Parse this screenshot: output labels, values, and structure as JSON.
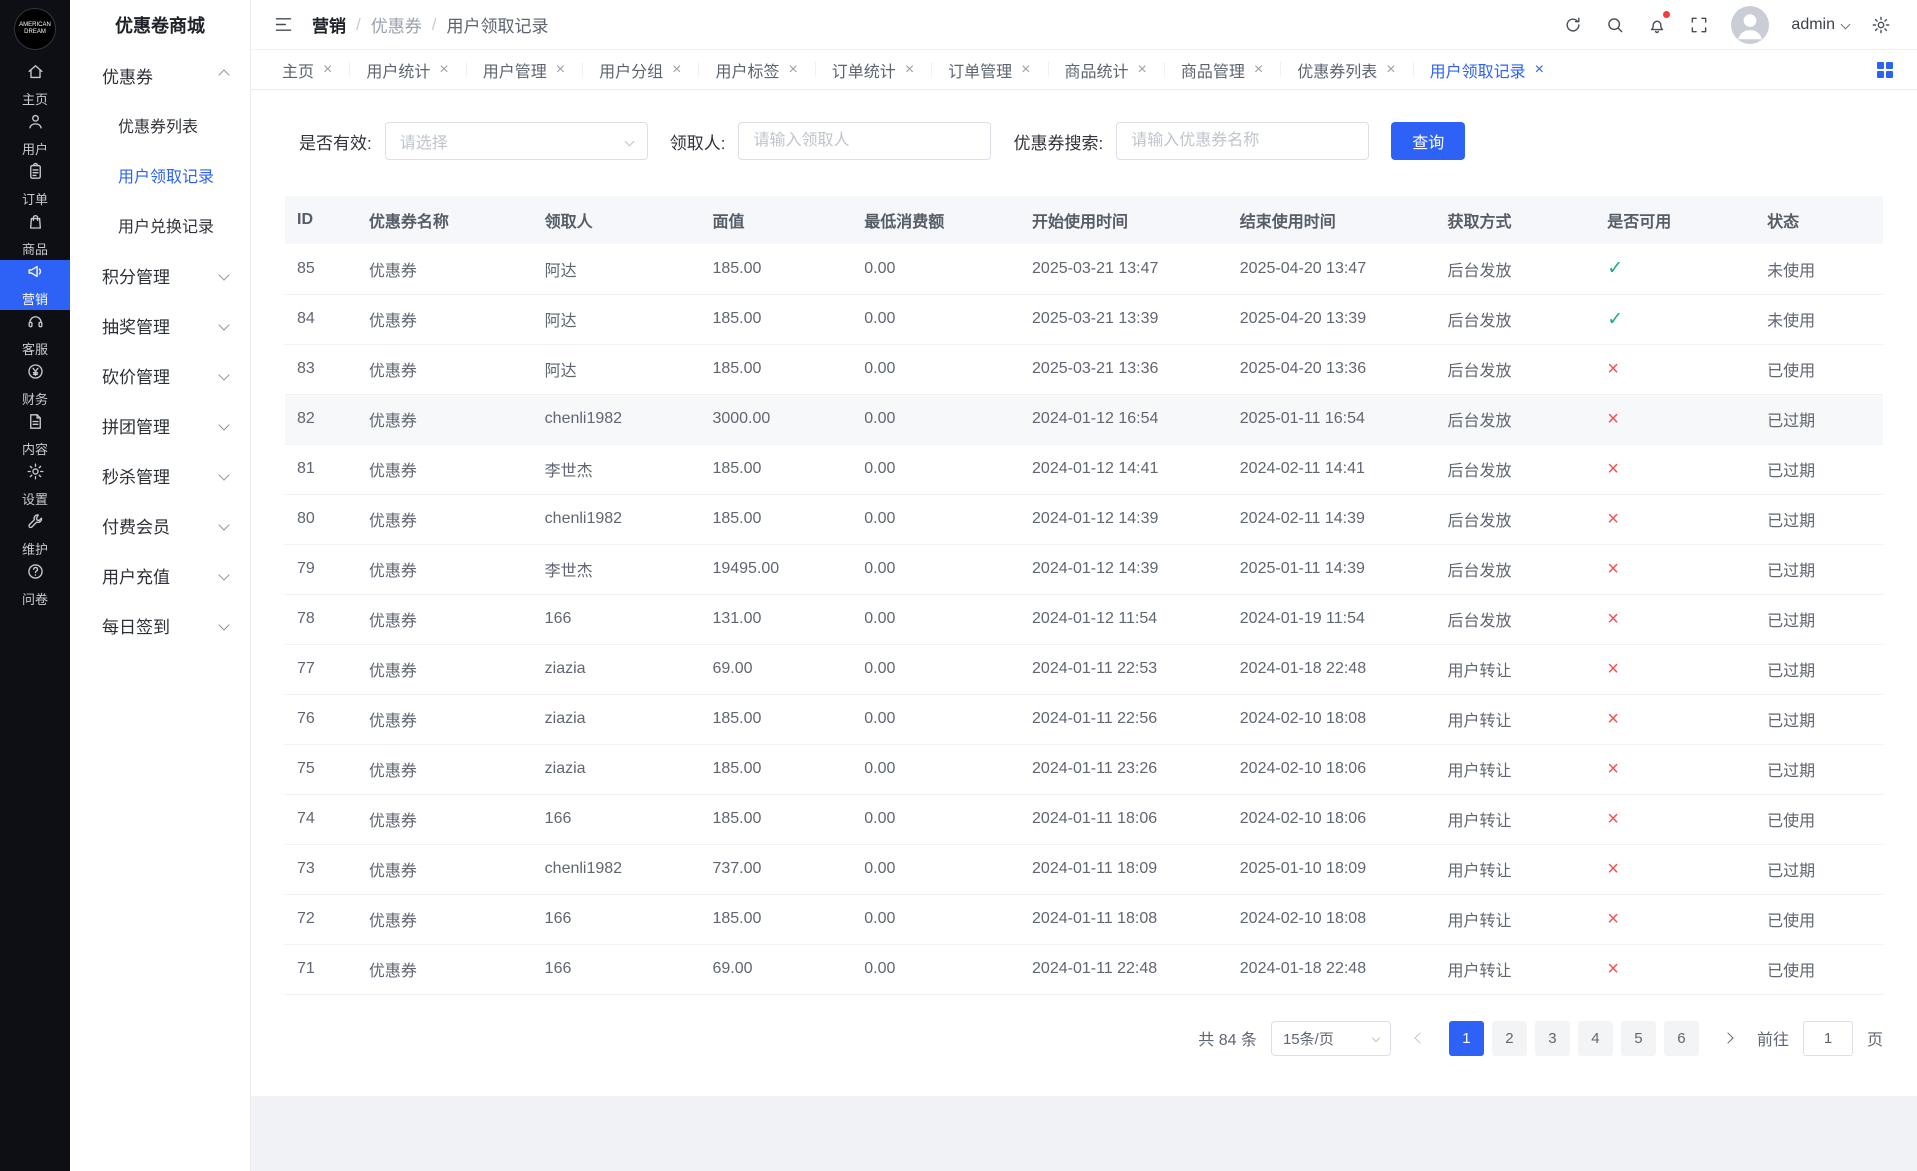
{
  "app": {
    "title": "优惠卷商城",
    "logo_text": "AMERICAN DREAM"
  },
  "ui": {
    "close_glyph": "×",
    "check_glyph": "✓",
    "cross_glyph": "×"
  },
  "colors": {
    "accent": "#2e62f6",
    "success": "#17b07f",
    "danger": "#f25050"
  },
  "rail": {
    "items": [
      {
        "label": "主页",
        "icon": "home",
        "active": false
      },
      {
        "label": "用户",
        "icon": "user",
        "active": false
      },
      {
        "label": "订单",
        "icon": "order",
        "active": false
      },
      {
        "label": "商品",
        "icon": "goods",
        "active": false
      },
      {
        "label": "营销",
        "icon": "marketing",
        "active": true
      },
      {
        "label": "客服",
        "icon": "service",
        "active": false
      },
      {
        "label": "财务",
        "icon": "finance",
        "active": false
      },
      {
        "label": "内容",
        "icon": "content",
        "active": false
      },
      {
        "label": "设置",
        "icon": "settings",
        "active": false
      },
      {
        "label": "维护",
        "icon": "maintain",
        "active": false
      },
      {
        "label": "问卷",
        "icon": "survey",
        "active": false
      }
    ]
  },
  "sidebar": {
    "groups": [
      {
        "label": "优惠券",
        "expanded": true,
        "children": [
          {
            "label": "优惠券列表",
            "active": false
          },
          {
            "label": "用户领取记录",
            "active": true
          },
          {
            "label": "用户兑换记录",
            "active": false
          }
        ]
      },
      {
        "label": "积分管理",
        "expanded": false,
        "children": []
      },
      {
        "label": "抽奖管理",
        "expanded": false,
        "children": []
      },
      {
        "label": "砍价管理",
        "expanded": false,
        "children": []
      },
      {
        "label": "拼团管理",
        "expanded": false,
        "children": []
      },
      {
        "label": "秒杀管理",
        "expanded": false,
        "children": []
      },
      {
        "label": "付费会员",
        "expanded": false,
        "children": []
      },
      {
        "label": "用户充值",
        "expanded": false,
        "children": []
      },
      {
        "label": "每日签到",
        "expanded": false,
        "children": []
      }
    ]
  },
  "header": {
    "breadcrumb": [
      "营销",
      "优惠券",
      "用户领取记录"
    ],
    "username": "admin"
  },
  "tabs": {
    "items": [
      {
        "label": "主页",
        "active": false
      },
      {
        "label": "用户统计",
        "active": false
      },
      {
        "label": "用户管理",
        "active": false
      },
      {
        "label": "用户分组",
        "active": false
      },
      {
        "label": "用户标签",
        "active": false
      },
      {
        "label": "订单统计",
        "active": false
      },
      {
        "label": "订单管理",
        "active": false
      },
      {
        "label": "商品统计",
        "active": false
      },
      {
        "label": "商品管理",
        "active": false
      },
      {
        "label": "优惠券列表",
        "active": false
      },
      {
        "label": "用户领取记录",
        "active": true
      }
    ]
  },
  "filters": {
    "valid_label": "是否有效:",
    "valid_placeholder": "请选择",
    "receiver_label": "领取人:",
    "receiver_placeholder": "请输入领取人",
    "coupon_label": "优惠券搜索:",
    "coupon_placeholder": "请输入优惠券名称",
    "search_button": "查询"
  },
  "table": {
    "columns": [
      "ID",
      "优惠券名称",
      "领取人",
      "面值",
      "最低消费额",
      "开始使用时间",
      "结束使用时间",
      "获取方式",
      "是否可用",
      "状态"
    ],
    "rows": [
      {
        "id": "85",
        "name": "优惠券",
        "receiver": "阿达",
        "value": "185.00",
        "min": "0.00",
        "start": "2025-03-21 13:47",
        "end": "2025-04-20 13:47",
        "method": "后台发放",
        "available": true,
        "status": "未使用",
        "highlighted": false
      },
      {
        "id": "84",
        "name": "优惠券",
        "receiver": "阿达",
        "value": "185.00",
        "min": "0.00",
        "start": "2025-03-21 13:39",
        "end": "2025-04-20 13:39",
        "method": "后台发放",
        "available": true,
        "status": "未使用",
        "highlighted": false
      },
      {
        "id": "83",
        "name": "优惠券",
        "receiver": "阿达",
        "value": "185.00",
        "min": "0.00",
        "start": "2025-03-21 13:36",
        "end": "2025-04-20 13:36",
        "method": "后台发放",
        "available": false,
        "status": "已使用",
        "highlighted": false
      },
      {
        "id": "82",
        "name": "优惠券",
        "receiver": "chenli1982",
        "value": "3000.00",
        "min": "0.00",
        "start": "2024-01-12 16:54",
        "end": "2025-01-11 16:54",
        "method": "后台发放",
        "available": false,
        "status": "已过期",
        "highlighted": true
      },
      {
        "id": "81",
        "name": "优惠券",
        "receiver": "李世杰",
        "value": "185.00",
        "min": "0.00",
        "start": "2024-01-12 14:41",
        "end": "2024-02-11 14:41",
        "method": "后台发放",
        "available": false,
        "status": "已过期",
        "highlighted": false
      },
      {
        "id": "80",
        "name": "优惠券",
        "receiver": "chenli1982",
        "value": "185.00",
        "min": "0.00",
        "start": "2024-01-12 14:39",
        "end": "2024-02-11 14:39",
        "method": "后台发放",
        "available": false,
        "status": "已过期",
        "highlighted": false
      },
      {
        "id": "79",
        "name": "优惠券",
        "receiver": "李世杰",
        "value": "19495.00",
        "min": "0.00",
        "start": "2024-01-12 14:39",
        "end": "2025-01-11 14:39",
        "method": "后台发放",
        "available": false,
        "status": "已过期",
        "highlighted": false
      },
      {
        "id": "78",
        "name": "优惠券",
        "receiver": "166",
        "value": "131.00",
        "min": "0.00",
        "start": "2024-01-12 11:54",
        "end": "2024-01-19 11:54",
        "method": "后台发放",
        "available": false,
        "status": "已过期",
        "highlighted": false
      },
      {
        "id": "77",
        "name": "优惠券",
        "receiver": "ziazia",
        "value": "69.00",
        "min": "0.00",
        "start": "2024-01-11 22:53",
        "end": "2024-01-18 22:48",
        "method": "用户转让",
        "available": false,
        "status": "已过期",
        "highlighted": false
      },
      {
        "id": "76",
        "name": "优惠券",
        "receiver": "ziazia",
        "value": "185.00",
        "min": "0.00",
        "start": "2024-01-11 22:56",
        "end": "2024-02-10 18:08",
        "method": "用户转让",
        "available": false,
        "status": "已过期",
        "highlighted": false
      },
      {
        "id": "75",
        "name": "优惠券",
        "receiver": "ziazia",
        "value": "185.00",
        "min": "0.00",
        "start": "2024-01-11 23:26",
        "end": "2024-02-10 18:06",
        "method": "用户转让",
        "available": false,
        "status": "已过期",
        "highlighted": false
      },
      {
        "id": "74",
        "name": "优惠券",
        "receiver": "166",
        "value": "185.00",
        "min": "0.00",
        "start": "2024-01-11 18:06",
        "end": "2024-02-10 18:06",
        "method": "用户转让",
        "available": false,
        "status": "已使用",
        "highlighted": false
      },
      {
        "id": "73",
        "name": "优惠券",
        "receiver": "chenli1982",
        "value": "737.00",
        "min": "0.00",
        "start": "2024-01-11 18:09",
        "end": "2025-01-10 18:09",
        "method": "用户转让",
        "available": false,
        "status": "已过期",
        "highlighted": false
      },
      {
        "id": "72",
        "name": "优惠券",
        "receiver": "166",
        "value": "185.00",
        "min": "0.00",
        "start": "2024-01-11 18:08",
        "end": "2024-02-10 18:08",
        "method": "用户转让",
        "available": false,
        "status": "已使用",
        "highlighted": false
      },
      {
        "id": "71",
        "name": "优惠券",
        "receiver": "166",
        "value": "69.00",
        "min": "0.00",
        "start": "2024-01-11 22:48",
        "end": "2024-01-18 22:48",
        "method": "用户转让",
        "available": false,
        "status": "已使用",
        "highlighted": false
      }
    ]
  },
  "pagination": {
    "total": "共 84 条",
    "page_size": "15条/页",
    "pages": [
      "1",
      "2",
      "3",
      "4",
      "5",
      "6"
    ],
    "active_page": "1",
    "goto_label": "前往",
    "goto_value": "1",
    "goto_unit": "页"
  }
}
